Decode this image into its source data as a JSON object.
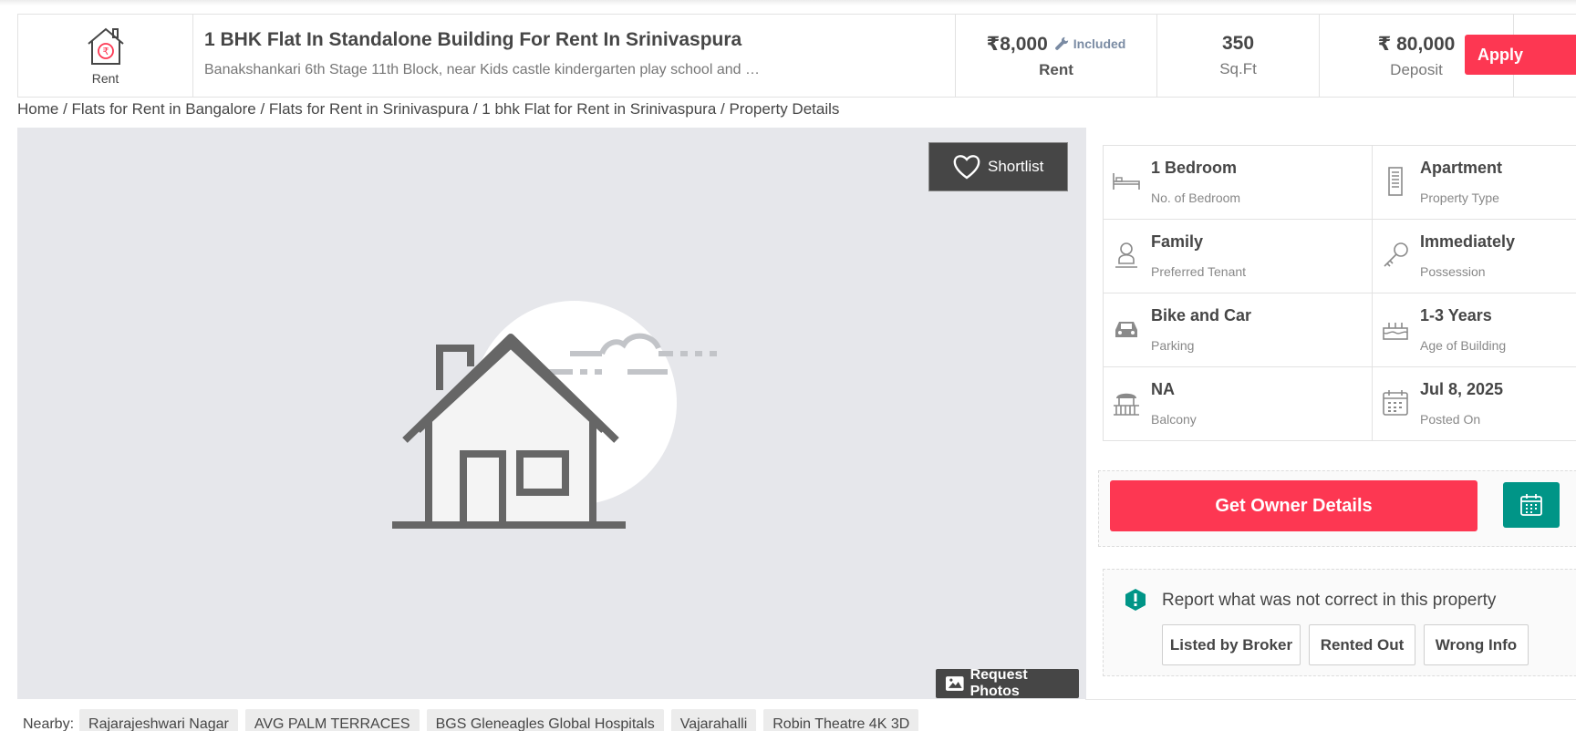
{
  "header": {
    "type_label": "Rent",
    "title": "1 BHK Flat In Standalone Building For Rent In Srinivaspura",
    "subtitle": "Banakshankari 6th Stage 11th Block, near Kids castle kindergarten play school and …",
    "rent_value": "₹8,000",
    "rent_included": "Included",
    "rent_label": "Rent",
    "area_value": "350",
    "area_unit": "Sq.Ft",
    "deposit_value": "₹ 80,000",
    "deposit_label": "Deposit",
    "apply_label": "Apply"
  },
  "breadcrumb": "Home / Flats for Rent in Bangalore / Flats for Rent in Srinivaspura / 1 bhk Flat for Rent in Srinivaspura / Property Details",
  "gallery": {
    "shortlist_label": "Shortlist",
    "request_photos_label": "Request Photos"
  },
  "details": [
    {
      "value": "1 Bedroom",
      "label": "No. of Bedroom",
      "icon": "bed-icon"
    },
    {
      "value": "Apartment",
      "label": "Property Type",
      "icon": "building-icon"
    },
    {
      "value": "Family",
      "label": "Preferred Tenant",
      "icon": "tenant-icon"
    },
    {
      "value": "Immediately",
      "label": "Possession",
      "icon": "key-icon"
    },
    {
      "value": "Bike and Car",
      "label": "Parking",
      "icon": "car-icon"
    },
    {
      "value": "1-3 Years",
      "label": "Age of Building",
      "icon": "cake-icon"
    },
    {
      "value": "NA",
      "label": "Balcony",
      "icon": "balcony-icon"
    },
    {
      "value": "Jul 8, 2025",
      "label": "Posted On",
      "icon": "calendar-icon"
    }
  ],
  "contact": {
    "owner_button_label": "Get Owner Details"
  },
  "report": {
    "title": "Report what was not correct in this property",
    "buttons": [
      "Listed by Broker",
      "Rented Out",
      "Wrong Info"
    ]
  },
  "nearby": {
    "label": "Nearby:",
    "items": [
      "Rajarajeshwari Nagar",
      "AVG PALM TERRACES",
      "BGS Gleneagles Global Hospitals",
      "Vajarahalli",
      "Robin Theatre 4K 3D"
    ]
  },
  "colors": {
    "accent": "#fd3752",
    "teal": "#009587",
    "dark": "#464646"
  }
}
